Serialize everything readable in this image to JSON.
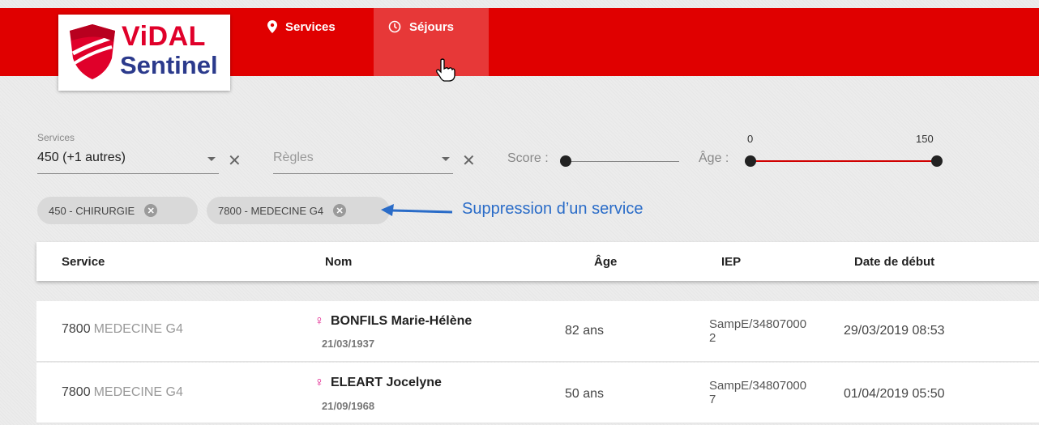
{
  "brand": {
    "line1": "ViDAL",
    "line2": "Sentinel",
    "red": "#e00000",
    "blue": "#2b3a8c"
  },
  "nav": {
    "items": [
      {
        "label": "Services",
        "icon": "map-marker-icon"
      },
      {
        "label": "Séjours",
        "icon": "clock-icon",
        "active": true
      }
    ]
  },
  "filters": {
    "services": {
      "label": "Services",
      "value": "450 (+1 autres)"
    },
    "regles": {
      "placeholder": "Règles"
    },
    "score": {
      "label": "Score :"
    },
    "age": {
      "label": "Âge :",
      "min": "0",
      "max": "150"
    }
  },
  "chips": [
    {
      "label": "450 - CHIRURGIE"
    },
    {
      "label": "7800 - MEDECINE G4"
    }
  ],
  "annotation": "Suppression d’un service",
  "table": {
    "headers": [
      "Service",
      "Nom",
      "Âge",
      "IEP",
      "Date de début"
    ],
    "rows": [
      {
        "service_code": "7800",
        "service_name": "MEDECINE G4",
        "name": "BONFILS Marie-Hélène",
        "dob": "21/03/1937",
        "age": "82 ans",
        "iep_1": "SampE/34807000",
        "iep_2": "2",
        "start": "29/03/2019 08:53"
      },
      {
        "service_code": "7800",
        "service_name": "MEDECINE G4",
        "name": "ELEART Jocelyne",
        "dob": "21/09/1968",
        "age": "50 ans",
        "iep_1": "SampE/34807000",
        "iep_2": "7",
        "start": "01/04/2019 05:50"
      }
    ]
  }
}
